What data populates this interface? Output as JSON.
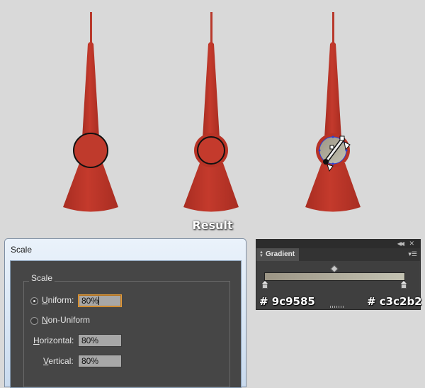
{
  "canvas": {
    "result_label": "Result",
    "colors": {
      "shape_red": "#c0392b",
      "shape_dark": "#a93226",
      "background": "#d9d9d9"
    }
  },
  "scale_dialog": {
    "title": "Scale",
    "group_label": "Scale",
    "uniform": {
      "label": "Uniform:",
      "value": "80%",
      "selected": true
    },
    "non_uniform": {
      "label": "Non-Uniform",
      "selected": false
    },
    "horizontal": {
      "label": "Horizontal:",
      "value": "80%"
    },
    "vertical": {
      "label": "Vertical:",
      "value": "80%"
    }
  },
  "gradient_panel": {
    "tab_label": "Gradient",
    "stop_left_color": "#9c9585",
    "stop_right_color": "#c3c2b2",
    "hex_left": "# 9c9585",
    "hex_right": "# c3c2b2"
  }
}
